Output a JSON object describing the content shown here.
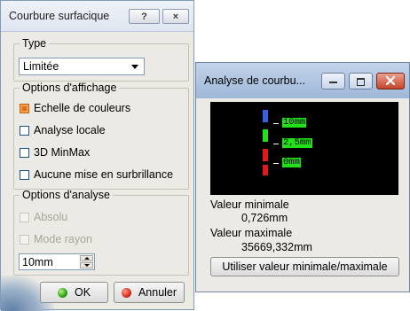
{
  "dialog1": {
    "title": "Courbure surfacique",
    "help_label": "?",
    "close_label": "×",
    "type_group": {
      "legend": "Type",
      "selected": "Limitée"
    },
    "display_group": {
      "legend": "Options d'affichage",
      "options": [
        {
          "label": "Echelle de couleurs",
          "checked": true
        },
        {
          "label": "Analyse locale",
          "checked": false
        },
        {
          "label": "3D MinMax",
          "checked": false
        },
        {
          "label": "Aucune mise en surbrillance",
          "checked": false
        }
      ]
    },
    "analysis_group": {
      "legend": "Options d'analyse",
      "options": [
        {
          "label": "Absolu",
          "checked": false,
          "enabled": false
        },
        {
          "label": "Mode rayon",
          "checked": false,
          "enabled": false
        }
      ],
      "value": "10mm"
    },
    "ok_label": "OK",
    "cancel_label": "Annuler"
  },
  "dialog2": {
    "title": "Analyse de courbu...",
    "scale": [
      {
        "label": "10mm",
        "color": "#3a5ee0"
      },
      {
        "label": "2,5mm",
        "color": "#22e01a"
      },
      {
        "label": "0mm",
        "color": "#e01a1a"
      }
    ],
    "min_label": "Valeur minimale",
    "min_value": "0,726mm",
    "max_label": "Valeur maximale",
    "max_value": "35669,332mm",
    "use_button": "Utiliser valeur minimale/maximale"
  }
}
